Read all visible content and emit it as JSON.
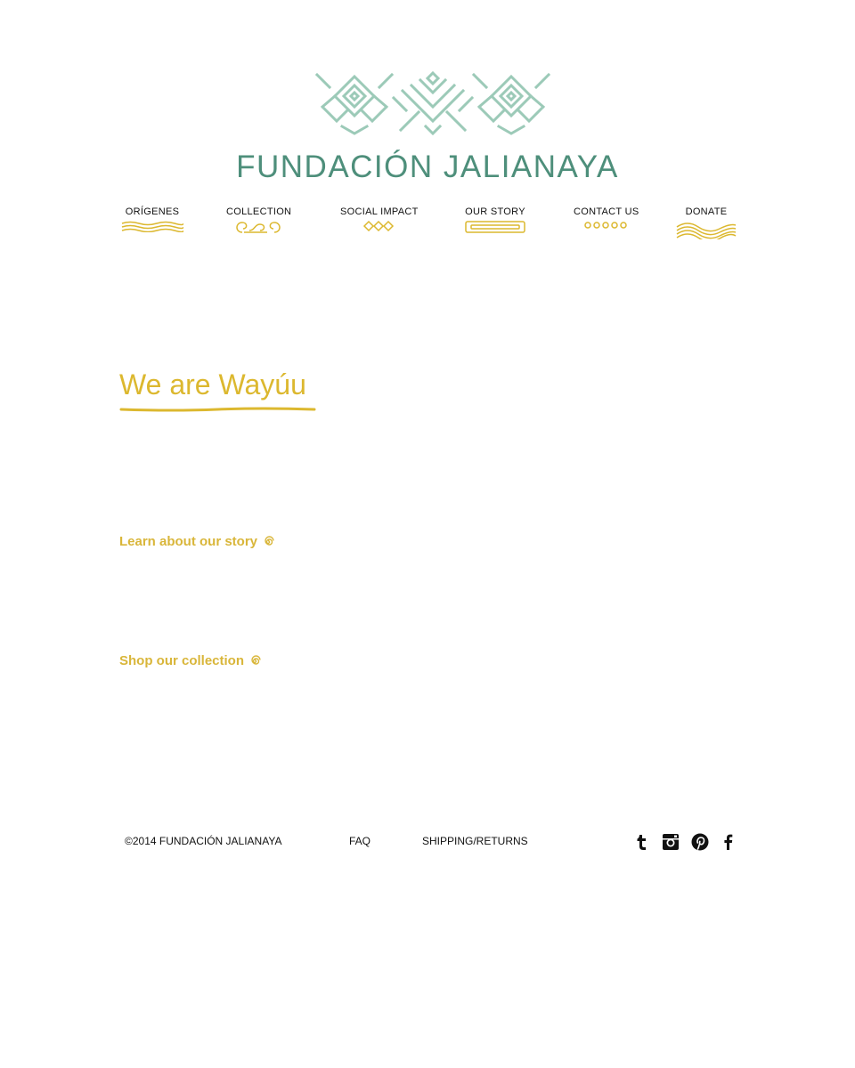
{
  "brand": {
    "name": "FUNDACIÓN JALIANAYA",
    "accent_teal": "#4e8f7b",
    "logo_teal": "#9ccab8",
    "accent_gold": "#dcb82f"
  },
  "nav": {
    "items": [
      {
        "label": "ORÍGENES",
        "icon": "wave-lines-icon"
      },
      {
        "label": "COLLECTION",
        "icon": "swirl-icon"
      },
      {
        "label": "SOCIAL IMPACT",
        "icon": "diamonds-icon"
      },
      {
        "label": "OUR STORY",
        "icon": "frame-icon"
      },
      {
        "label": "CONTACT US",
        "icon": "dots-icon"
      },
      {
        "label": "DONATE",
        "icon": "waves-icon"
      }
    ]
  },
  "main": {
    "headline": "We are Wayúu",
    "cta_story": "Learn about our story",
    "cta_shop": "Shop our collection"
  },
  "footer": {
    "copyright": "©2014 FUNDACIÓN JALIANAYA",
    "faq": "FAQ",
    "shipping": "SHIPPING/RETURNS",
    "social": [
      "tumblr-icon",
      "instagram-icon",
      "pinterest-icon",
      "facebook-icon"
    ]
  }
}
